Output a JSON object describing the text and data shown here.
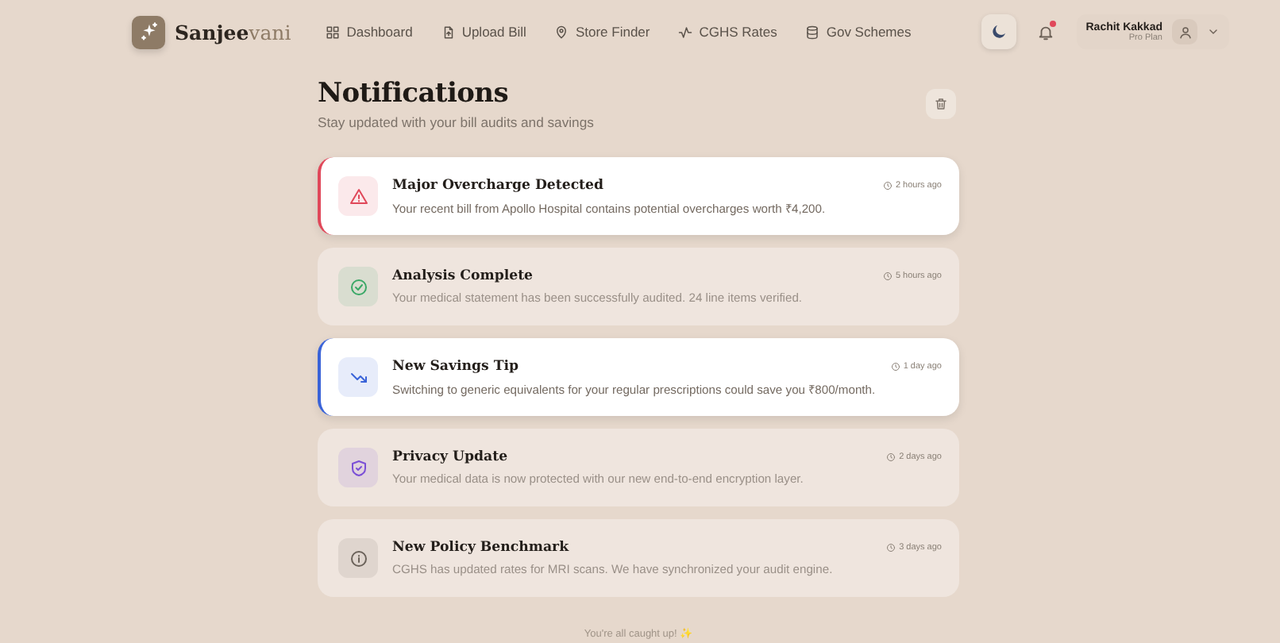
{
  "brand": {
    "name_main": "Sanjee",
    "name_accent": "vani"
  },
  "nav": [
    {
      "label": "Dashboard",
      "kind": "grid",
      "selected": false
    },
    {
      "label": "Upload Bill",
      "kind": "file",
      "selected": false
    },
    {
      "label": "Store Finder",
      "kind": "pin",
      "selected": false
    },
    {
      "label": "CGHS Rates",
      "kind": "pulse",
      "selected": false
    },
    {
      "label": "Gov Schemes",
      "kind": "db",
      "selected": false
    }
  ],
  "notifications_badge": true,
  "user": {
    "name": "Rachit Kakkad",
    "plan": "Pro Plan"
  },
  "page": {
    "title": "Notifications",
    "subtitle": "Stay updated with your bill audits and savings"
  },
  "notifications": [
    {
      "kind": "alert",
      "color": "#e0485a",
      "unread": true,
      "title": "Major Overcharge Detected",
      "time": "2 hours ago",
      "message": "Your recent bill from Apollo Hospital contains potential overcharges worth ₹4,200."
    },
    {
      "kind": "check",
      "color": "#3aa867",
      "unread": false,
      "title": "Analysis Complete",
      "time": "5 hours ago",
      "message": "Your medical statement has been successfully audited. 24 line items verified."
    },
    {
      "kind": "trend",
      "color": "#3a63d8",
      "unread": true,
      "title": "New Savings Tip",
      "time": "1 day ago",
      "message": "Switching to generic equivalents for your regular prescriptions could save you ₹800/month."
    },
    {
      "kind": "shield",
      "color": "#7b4fd6",
      "unread": false,
      "title": "Privacy Update",
      "time": "2 days ago",
      "message": "Your medical data is now protected with our new end-to-end encryption layer."
    },
    {
      "kind": "info",
      "color": "#6b625a",
      "unread": false,
      "title": "New Policy Benchmark",
      "time": "3 days ago",
      "message": "CGHS has updated rates for MRI scans. We have synchronized your audit engine."
    }
  ],
  "footer": "You're all caught up! ✨"
}
